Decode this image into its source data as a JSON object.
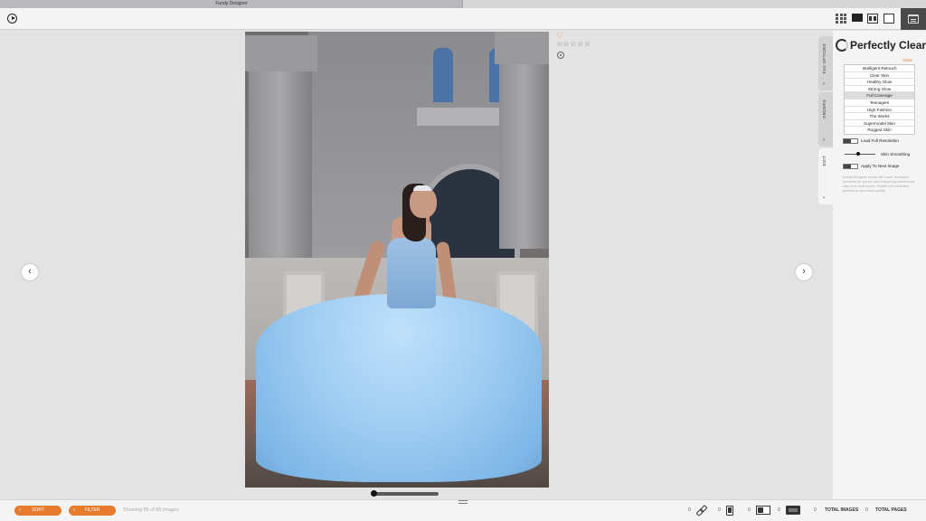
{
  "window": {
    "title": "Fundy Designer"
  },
  "toolbar": {
    "view_icons": [
      "grid-view-icon",
      "single-view-icon",
      "compare-view-icon",
      "fullscreen-view-icon"
    ],
    "calendar_icon": "calendar-icon"
  },
  "photo": {
    "rating_stars": "☆☆☆☆☆",
    "heart": "♡"
  },
  "nav": {
    "prev": "‹",
    "next": "›"
  },
  "side_tabs": [
    {
      "label": "TAG OPTIONS",
      "chevron": "›"
    },
    {
      "label": "ORDERS",
      "chevron": "›"
    },
    {
      "label": "EDIT",
      "chevron": "›"
    }
  ],
  "panel": {
    "title": "Perfectly Clear",
    "clear_label": "Clear",
    "presets": [
      "Intelligent Retouch",
      "Clear Skin",
      "Healthy Glow",
      "Strong Glow",
      "Full Coverage",
      "Teenagers",
      "High Fashion",
      "The Works",
      "Supermodel Skin",
      "Rugged Skin"
    ],
    "selected_preset": "Full Coverage",
    "load_full_resolution": "Load Full Resolution",
    "skin_smoothing": "Skin Smoothing",
    "apply_next": "Apply To Next Image",
    "toggle_off": "OFF",
    "toggle_on": "ON",
    "help_text": "Fundy Designer works with lower resolution previews for speed, and retouching results may vary from final export. Enable full resolution preview to see exact quality."
  },
  "bottombar": {
    "sort_label": "SORT",
    "filter_label": "FILTER",
    "showing": "Showing 85 of 85 images",
    "counts": [
      "0",
      "0",
      "0",
      "0",
      "0",
      "0"
    ],
    "total_images": "TOTAL IMAGES",
    "total_pages": "TOTAL PAGES"
  },
  "colors": {
    "accent": "#e67b2e",
    "panel_bg": "#f4f4f4",
    "stage_bg": "#e3e3e3"
  }
}
